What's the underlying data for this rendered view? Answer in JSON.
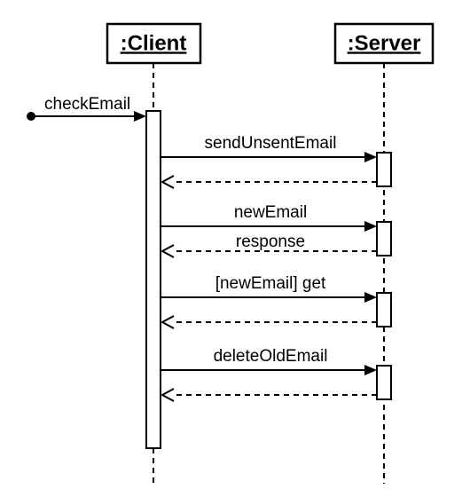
{
  "lifelines": {
    "client": ":Client",
    "server": ":Server"
  },
  "messages": {
    "checkEmail": "checkEmail",
    "sendUnsentEmail": "sendUnsentEmail",
    "newEmail": "newEmail",
    "response": "response",
    "newEmailGet": "[newEmail] get",
    "deleteOldEmail": "deleteOldEmail"
  }
}
